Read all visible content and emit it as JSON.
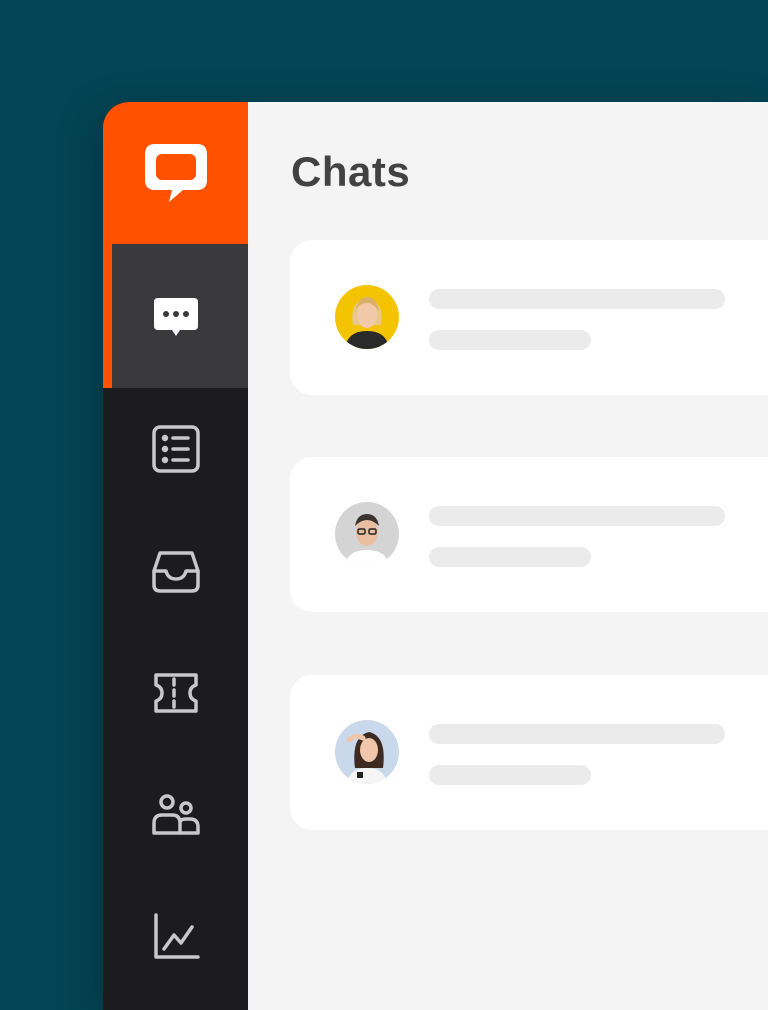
{
  "page": {
    "title": "Chats"
  },
  "colors": {
    "background": "#034554",
    "brand": "#ff5100",
    "sidebar": "#1c1c1e",
    "sidebar_active": "#3a3a3c",
    "content": "#f4f4f4",
    "card": "#ffffff",
    "placeholder": "#ebebeb"
  },
  "sidebar": {
    "logo_icon": "chat-bubble-logo-icon",
    "items": [
      {
        "icon": "chats-icon",
        "active": true
      },
      {
        "icon": "list-icon",
        "active": false
      },
      {
        "icon": "inbox-icon",
        "active": false
      },
      {
        "icon": "ticket-icon",
        "active": false
      },
      {
        "icon": "customers-icon",
        "active": false
      },
      {
        "icon": "reports-icon",
        "active": false
      }
    ]
  },
  "chats": [
    {
      "avatar": "avatar-blonde-woman",
      "avatar_bg": "#f5c400"
    },
    {
      "avatar": "avatar-man-glasses",
      "avatar_bg": "#d4d4d4"
    },
    {
      "avatar": "avatar-dark-haired-woman",
      "avatar_bg": "#c9d8ea"
    }
  ]
}
